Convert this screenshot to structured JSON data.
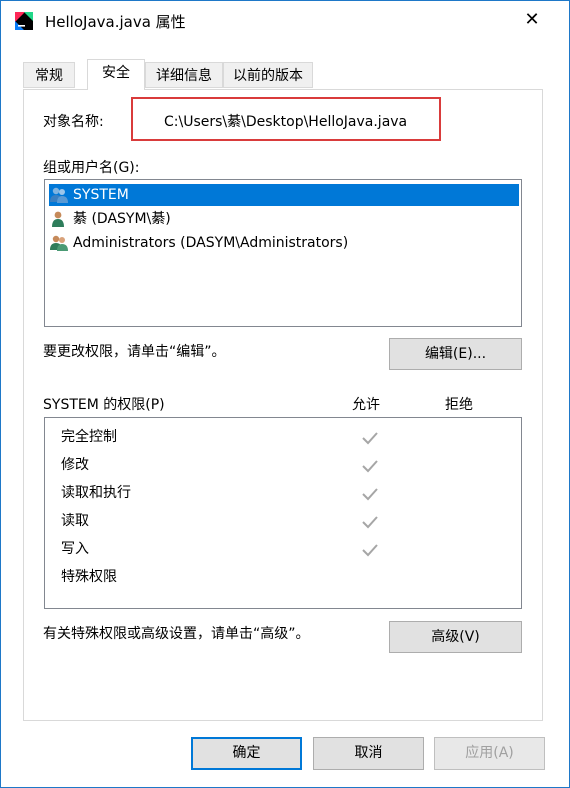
{
  "window": {
    "title": "HelloJava.java 属性",
    "close_glyph": "✕"
  },
  "tabs": [
    {
      "label": "常规",
      "active": false
    },
    {
      "label": "安全",
      "active": true
    },
    {
      "label": "详细信息",
      "active": false
    },
    {
      "label": "以前的版本",
      "active": false
    }
  ],
  "security": {
    "object_name_label": "对象名称:",
    "object_name_value": "C:\\Users\\綦\\Desktop\\HelloJava.java",
    "highlight_color": "#d93b3b",
    "groups_label": "组或用户名(G):",
    "groups": [
      {
        "name": "SYSTEM",
        "icon": "users-group-icon",
        "selected": true
      },
      {
        "name": "綦 (DASYM\\綦)",
        "icon": "user-icon",
        "selected": false
      },
      {
        "name": "Administrators (DASYM\\Administrators)",
        "icon": "users-group-icon",
        "selected": false
      }
    ],
    "edit_hint": "要更改权限，请单击“编辑”。",
    "edit_button": "编辑(E)...",
    "permissions_label": "SYSTEM 的权限(P)",
    "allow_header": "允许",
    "deny_header": "拒绝",
    "permissions": [
      {
        "name": "完全控制",
        "allow": true
      },
      {
        "name": "修改",
        "allow": true
      },
      {
        "name": "读取和执行",
        "allow": true
      },
      {
        "name": "读取",
        "allow": true
      },
      {
        "name": "写入",
        "allow": true
      },
      {
        "name": "特殊权限",
        "allow": false
      }
    ],
    "advanced_hint": "有关特殊权限或高级设置，请单击“高级”。",
    "advanced_button": "高级(V)"
  },
  "footer": {
    "ok": "确定",
    "cancel": "取消",
    "apply": "应用(A)"
  },
  "colors": {
    "accent": "#0078d7",
    "selection": "#0078d7",
    "button_bg": "#e1e1e1"
  }
}
